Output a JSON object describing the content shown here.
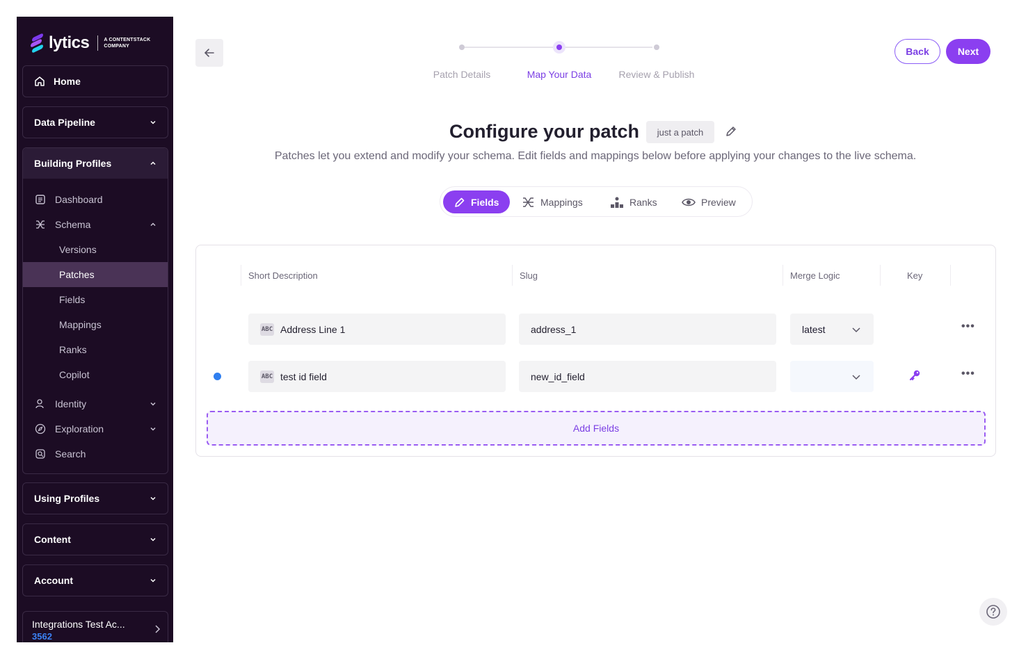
{
  "brand": {
    "name": "lytics",
    "sub_line1": "A CONTENTSTACK",
    "sub_line2": "COMPANY"
  },
  "sidebar": {
    "home": "Home",
    "data_pipeline": "Data Pipeline",
    "building_profiles": "Building Profiles",
    "building_items": {
      "dashboard": "Dashboard",
      "schema": "Schema",
      "versions": "Versions",
      "patches": "Patches",
      "fields": "Fields",
      "mappings": "Mappings",
      "ranks": "Ranks",
      "copilot": "Copilot",
      "identity": "Identity",
      "exploration": "Exploration",
      "search": "Search"
    },
    "using_profiles": "Using Profiles",
    "content": "Content",
    "account": "Account",
    "account_switcher": {
      "name": "Integrations Test Ac...",
      "id": "3562"
    }
  },
  "stepper": {
    "steps": [
      "Patch Details",
      "Map Your Data",
      "Review & Publish"
    ],
    "active_index": 1
  },
  "actions": {
    "back": "Back",
    "next": "Next"
  },
  "header": {
    "title": "Configure your patch",
    "patch_name": "just a patch",
    "subtitle": "Patches let you extend and modify your schema. Edit fields and mappings below before applying your changes to the live schema."
  },
  "tabs": [
    "Fields",
    "Mappings",
    "Ranks",
    "Preview"
  ],
  "active_tab": "Fields",
  "table": {
    "columns": {
      "short_description": "Short Description",
      "slug": "Slug",
      "merge_logic": "Merge Logic",
      "key": "Key"
    },
    "rows": [
      {
        "type_badge": "ABC",
        "short_description": "Address Line 1",
        "slug": "address_1",
        "merge_logic": "latest",
        "is_key": false,
        "is_new": false
      },
      {
        "type_badge": "ABC",
        "short_description": "test id field",
        "slug": "new_id_field",
        "merge_logic": "",
        "is_key": true,
        "is_new": true
      }
    ],
    "add_fields": "Add Fields"
  },
  "colors": {
    "accent": "#8b3ff0",
    "sidebar_bg": "#1c0c24",
    "new_dot": "#2f7ff0"
  }
}
